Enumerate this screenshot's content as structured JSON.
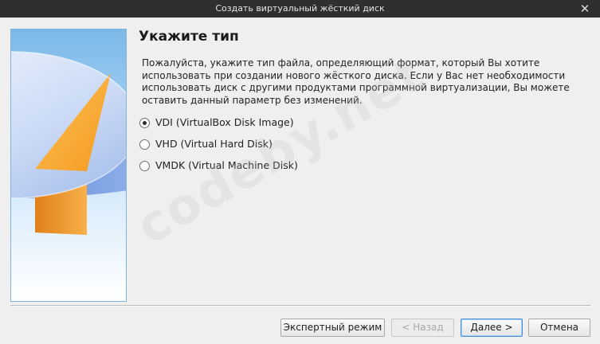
{
  "window": {
    "title": "Создать виртуальный жёсткий диск",
    "close_glyph": "✕"
  },
  "page": {
    "title": "Укажите тип",
    "description": "Пожалуйста, укажите тип файла, определяющий формат, который Вы хотите использовать при создании нового жёсткого диска. Если у Вас нет необходимости использовать диск с другими продуктами программной виртуализации, Вы можете оставить данный параметр без изменений."
  },
  "options": [
    {
      "label": "VDI (VirtualBox Disk Image)",
      "selected": true
    },
    {
      "label": "VHD (Virtual Hard Disk)",
      "selected": false
    },
    {
      "label": "VMDK (Virtual Machine Disk)",
      "selected": false
    }
  ],
  "buttons": {
    "expert": "Экспертный режим",
    "back": "< Назад",
    "next": "Далее >",
    "cancel": "Отмена"
  },
  "watermark": "codeby.net",
  "icons": {
    "close": "close-icon",
    "side_image": "hard-disk-illustration"
  },
  "colors": {
    "titlebar": "#2f2f2f",
    "background": "#efefef",
    "default_button_border": "#4a90d9",
    "disk_orange": "#f7a72e",
    "disk_blue": "#5f87d6"
  }
}
